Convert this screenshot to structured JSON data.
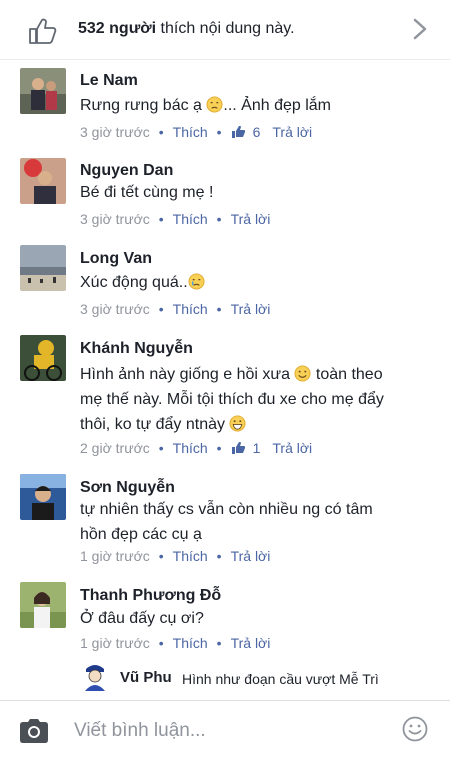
{
  "likes_bar": {
    "count": "532 người",
    "text": " thích nội dung này.",
    "thumb_icon": "thumbs-up-icon",
    "chevron_icon": "chevron-right-icon"
  },
  "comments": [
    {
      "name": "Le Nam",
      "text_before": "Rưng rưng bác ạ ",
      "emoji": "sad-face",
      "text_after": "... Ảnh đẹp lắm",
      "time": "3 giờ trước",
      "like_label": "Thích",
      "like_count": "6",
      "reply_label": "Trả lời"
    },
    {
      "name": "Nguyen Dan",
      "text": "Bé  đi tết cùng mẹ !",
      "time": "3 giờ trước",
      "like_label": "Thích",
      "reply_label": "Trả lời"
    },
    {
      "name": "Long Van",
      "text_before": "Xúc động quá..",
      "emoji": "crying-face",
      "time": "3 giờ trước",
      "like_label": "Thích",
      "reply_label": "Trả lời"
    },
    {
      "name": "Khánh Nguyễn",
      "line1_before": "Hình ảnh này giống e hồi xưa ",
      "line1_after": " toàn theo",
      "line2": "mẹ thế này. Mỗi tội thích đu xe cho mẹ đẩy",
      "line3_before": "thôi, ko tự đẩy ntnày ",
      "time": "2 giờ trước",
      "like_label": "Thích",
      "like_count": "1",
      "reply_label": "Trả lời"
    },
    {
      "name": "Sơn Nguyễn",
      "line1": "tự nhiên thấy cs vẫn còn nhiều ng có tâm",
      "line2": "hồn đẹp các cụ ạ",
      "time": "1 giờ trước",
      "like_label": "Thích",
      "reply_label": "Trả lời"
    },
    {
      "name": "Thanh Phương Đỗ",
      "text": "Ở đâu đấy cụ ơi?",
      "time": "1 giờ trước",
      "like_label": "Thích",
      "reply_label": "Trả lời"
    }
  ],
  "reply": {
    "name": "Vũ Phu",
    "text": "Hình như đoạn cầu vượt Mễ Trì"
  },
  "composer": {
    "placeholder": "Viết bình luận...",
    "camera_icon": "camera-icon",
    "emoji_icon": "smiley-icon"
  },
  "colors": {
    "link": "#4b66a4",
    "meta": "#90949c",
    "text": "#1d2129"
  }
}
